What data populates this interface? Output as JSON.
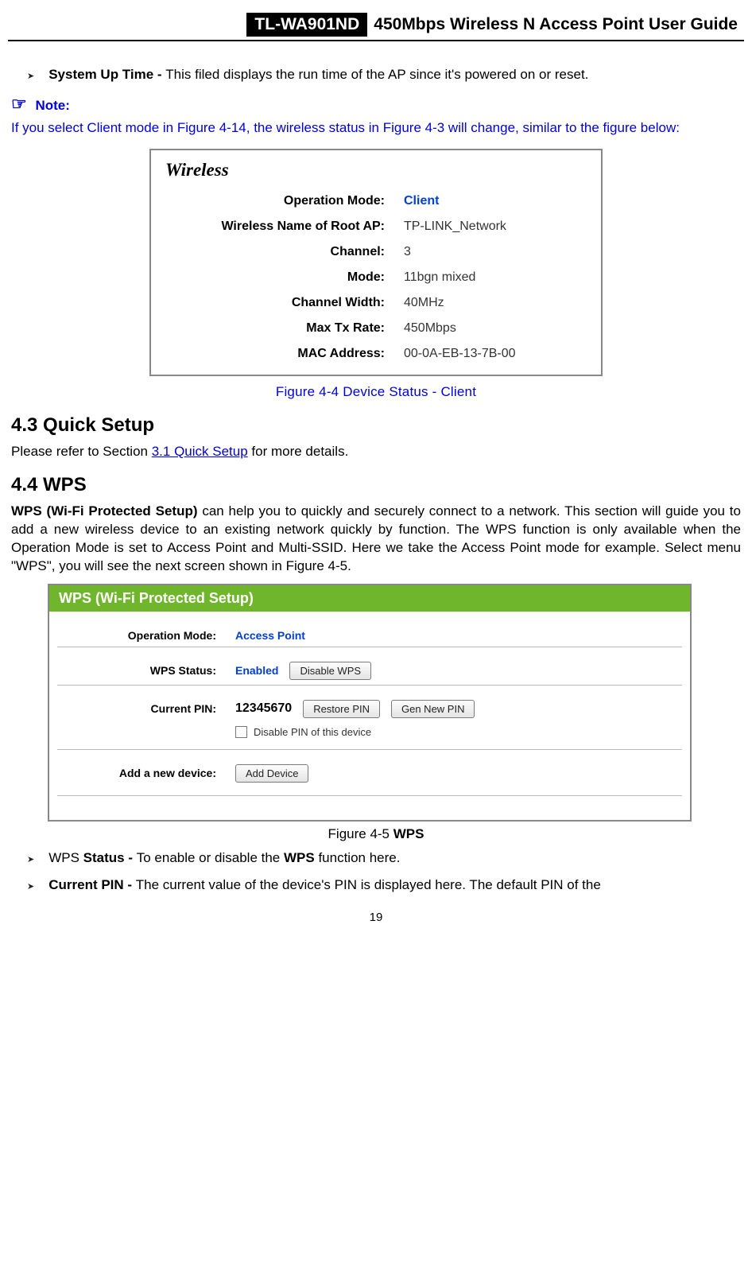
{
  "header": {
    "model": "TL-WA901ND",
    "title": "450Mbps Wireless N Access Point User Guide"
  },
  "bullet_sysup": {
    "bold": "System Up Time - ",
    "text": "This filed displays the run time of the AP since it's powered on or reset."
  },
  "note": {
    "label": "Note:",
    "body": "If you select Client mode in Figure 4-14, the wireless status in Figure 4-3 will change, similar to the figure below:"
  },
  "fig44": {
    "heading": "Wireless",
    "rows": [
      {
        "label": "Operation Mode:",
        "value": "Client",
        "blue": true
      },
      {
        "label": "Wireless Name of Root AP:",
        "value": "TP-LINK_Network"
      },
      {
        "label": "Channel:",
        "value": "3"
      },
      {
        "label": "Mode:",
        "value": "11bgn mixed"
      },
      {
        "label": "Channel Width:",
        "value": "40MHz"
      },
      {
        "label": "Max Tx Rate:",
        "value": "450Mbps"
      },
      {
        "label": "MAC Address:",
        "value": "00-0A-EB-13-7B-00"
      }
    ],
    "caption": "Figure 4-4    Device Status - Client"
  },
  "sec43": {
    "title": "4.3    Quick Setup",
    "text_before": "Please refer to Section ",
    "link": "3.1 Quick Setup",
    "text_after": " for more details."
  },
  "sec44": {
    "title": "4.4    WPS",
    "para_bold": "WPS (Wi-Fi Protected Setup) ",
    "para_rest": "can help you to quickly and securely connect to a network. This section will guide you to add a new wireless device to an existing network quickly by function. The WPS function is only available when the Operation Mode is set to Access Point and Multi-SSID. Here we take the Access Point mode for example. Select menu \"WPS\", you will see the next screen shown in Figure 4-5."
  },
  "wps": {
    "header": "WPS (Wi-Fi Protected Setup)",
    "op_mode_label": "Operation Mode:",
    "op_mode_value": "Access Point",
    "status_label": "WPS Status:",
    "status_value": "Enabled",
    "disable_btn": "Disable WPS",
    "pin_label": "Current PIN:",
    "pin_value": "12345670",
    "restore_btn": "Restore PIN",
    "gen_btn": "Gen New PIN",
    "disable_pin": "Disable PIN of this device",
    "add_label": "Add a new device:",
    "add_btn": "Add Device"
  },
  "fig45_caption_a": "Figure 4-5    ",
  "fig45_caption_b": "WPS",
  "bullets_end": [
    {
      "pre": "WPS ",
      "bold": "Status - ",
      "text": "To enable or disable the ",
      "bold2": "WPS",
      "text2": " function here."
    },
    {
      "pre": "",
      "bold": "Current PIN - ",
      "text": "The current value of the device's PIN is displayed here. The default PIN of the"
    }
  ],
  "pagenum": "19"
}
